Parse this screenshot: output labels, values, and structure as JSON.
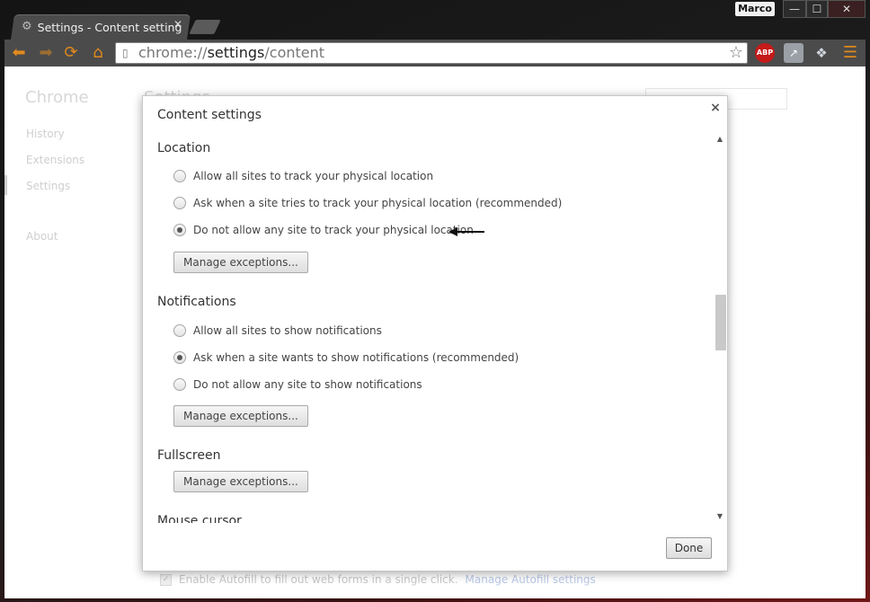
{
  "window": {
    "tab_title": "Settings - Content settings",
    "user_name": "Marco",
    "minimize_glyph": "—",
    "maximize_glyph": "☐",
    "close_glyph": "✕"
  },
  "toolbar": {
    "url_scheme": "chrome://",
    "url_host": "settings",
    "url_path": "/content",
    "abp_label": "ABP"
  },
  "icons": {
    "back": "arrow-left-icon",
    "forward": "arrow-right-icon",
    "reload": "reload-icon",
    "home": "home-icon",
    "bookmark": "star-icon",
    "menu": "hamburger-icon"
  },
  "colors": {
    "accent_orange": "#e08a1e",
    "abp_red": "#c41a1a"
  },
  "background_page": {
    "brand": "Chrome",
    "heading": "Settings",
    "nav_items": [
      "History",
      "Extensions",
      "Settings",
      "About"
    ],
    "autofill_text": "Enable Autofill to fill out web forms in a single click.",
    "autofill_link": "Manage Autofill settings"
  },
  "dialog": {
    "title": "Content settings",
    "close_glyph": "×",
    "done_label": "Done",
    "sections": {
      "location": {
        "title": "Location",
        "options": [
          "Allow all sites to track your physical location",
          "Ask when a site tries to track your physical location (recommended)",
          "Do not allow any site to track your physical location"
        ],
        "selected_index": 2,
        "manage_label": "Manage exceptions..."
      },
      "notifications": {
        "title": "Notifications",
        "options": [
          "Allow all sites to show notifications",
          "Ask when a site wants to show notifications (recommended)",
          "Do not allow any site to show notifications"
        ],
        "selected_index": 1,
        "manage_label": "Manage exceptions..."
      },
      "fullscreen": {
        "title": "Fullscreen",
        "manage_label": "Manage exceptions..."
      },
      "mouse_cursor": {
        "title": "Mouse cursor"
      }
    }
  }
}
